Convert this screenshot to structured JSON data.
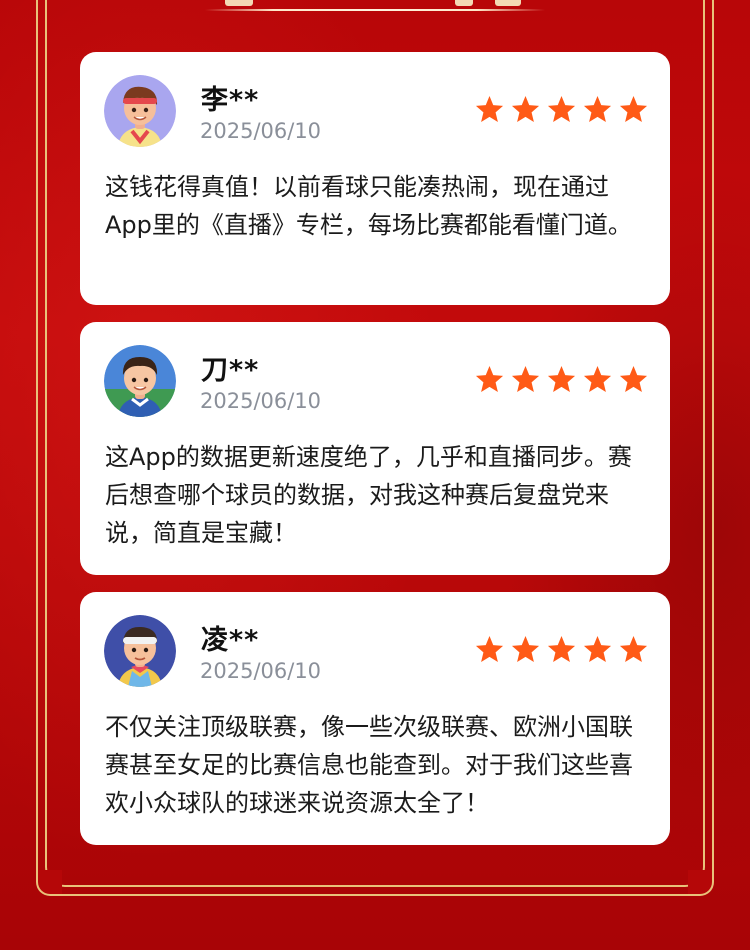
{
  "theme": {
    "background": "#b80608",
    "frame_gold": "#e9c27a",
    "star_color": "#ff5a16",
    "card_bg": "#ffffff",
    "date_color": "#8a8f99"
  },
  "reviews": [
    {
      "name": "李**",
      "date": "2025/06/10",
      "rating": 5,
      "avatar_icon": "boy-headband-avatar-icon",
      "text": "这钱花得真值！以前看球只能凑热闹，现在通过App里的《直播》专栏，每场比赛都能看懂门道。"
    },
    {
      "name": "刀**",
      "date": "2025/06/10",
      "rating": 5,
      "avatar_icon": "boy-stadium-avatar-icon",
      "text": "这App的数据更新速度绝了，几乎和直播同步。赛后想查哪个球员的数据，对我这种赛后复盘党来说，简直是宝藏！"
    },
    {
      "name": "凌**",
      "date": "2025/06/10",
      "rating": 5,
      "avatar_icon": "boy-bandana-avatar-icon",
      "text": "不仅关注顶级联赛，像一些次级联赛、欧洲小国联赛甚至女足的比赛信息也能查到。对于我们这些喜欢小众球队的球迷来说资源太全了！"
    }
  ]
}
